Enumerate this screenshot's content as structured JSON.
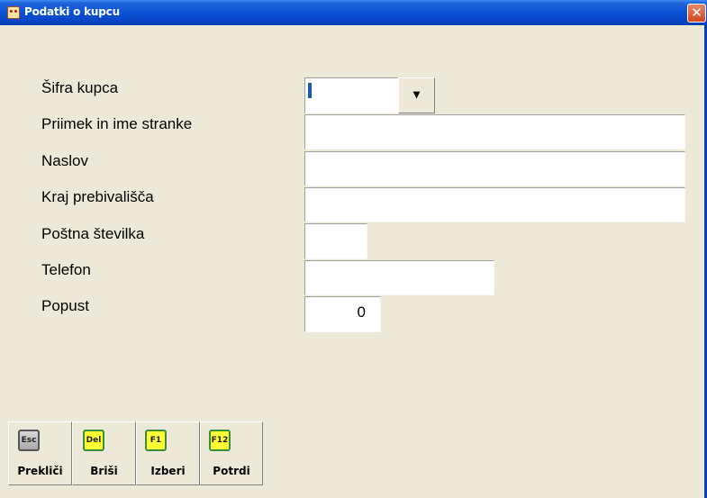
{
  "window": {
    "title": "Podatki o kupcu",
    "close_glyph": "✕"
  },
  "form": {
    "fields": [
      {
        "label": "Šifra kupca",
        "value": ""
      },
      {
        "label": "Priimek in ime stranke",
        "value": ""
      },
      {
        "label": "Naslov",
        "value": ""
      },
      {
        "label": "Kraj prebivališča",
        "value": ""
      },
      {
        "label": "Poštna številka",
        "value": ""
      },
      {
        "label": "Telefon",
        "value": ""
      },
      {
        "label": "Popust",
        "value": "0"
      }
    ],
    "dropdown_glyph": "▾"
  },
  "toolbar": {
    "buttons": [
      {
        "key": "Esc",
        "label": "Prekliči"
      },
      {
        "key": "Del",
        "label": "Briši"
      },
      {
        "key": "F1",
        "label": "Izberi"
      },
      {
        "key": "F12",
        "label": "Potrdi"
      }
    ]
  },
  "icons": [
    "app-icon",
    "close-icon",
    "dropdown-arrow-icon",
    "esc-key-icon",
    "del-key-icon",
    "f1-key-icon",
    "f12-key-icon"
  ]
}
